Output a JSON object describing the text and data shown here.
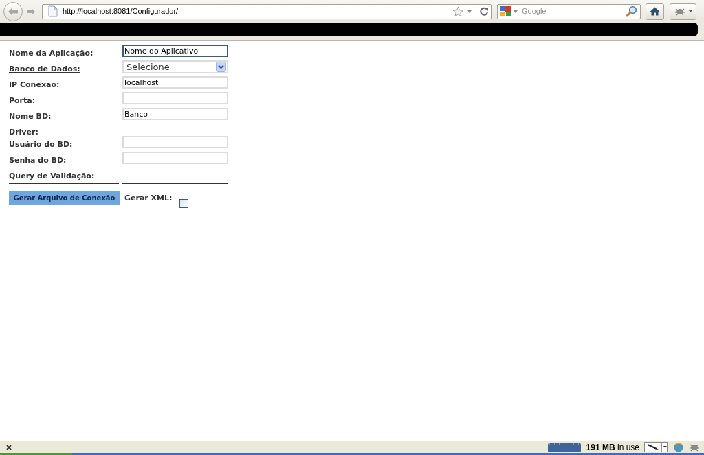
{
  "browser": {
    "address": "http://localhost:8081/Configurador/",
    "search_placeholder": "Google"
  },
  "form": {
    "fields": [
      {
        "kind": "text",
        "label": "Nome da Aplicação:",
        "underlined": false,
        "value": "Nome do Aplicativo",
        "focused": true
      },
      {
        "kind": "select",
        "label": "Banco de Dados:",
        "underlined": true,
        "value": "Selecione",
        "focused": false
      },
      {
        "kind": "text",
        "label": "IP Conexão:",
        "underlined": false,
        "value": "localhost",
        "focused": false
      },
      {
        "kind": "text",
        "label": "Porta:",
        "underlined": false,
        "focused": false
      },
      {
        "kind": "text",
        "label": "Nome BD:",
        "underlined": false,
        "value": "Banco",
        "focused": false
      },
      {
        "kind": "label",
        "label": "Driver:",
        "underlined": false
      },
      {
        "kind": "text",
        "label": "Usuário do BD:",
        "underlined": false,
        "focused": false
      },
      {
        "kind": "text",
        "label": "Senha do BD:",
        "underlined": false,
        "focused": false
      },
      {
        "kind": "label",
        "label": "Query de Validação:",
        "underlined": false
      }
    ],
    "generate_button": "Gerar Arquivo de Conexão",
    "xml_option": {
      "label": "Gerar XML:",
      "checked": false
    }
  },
  "status_bar": {
    "memory": "**191 MB** in use"
  }
}
